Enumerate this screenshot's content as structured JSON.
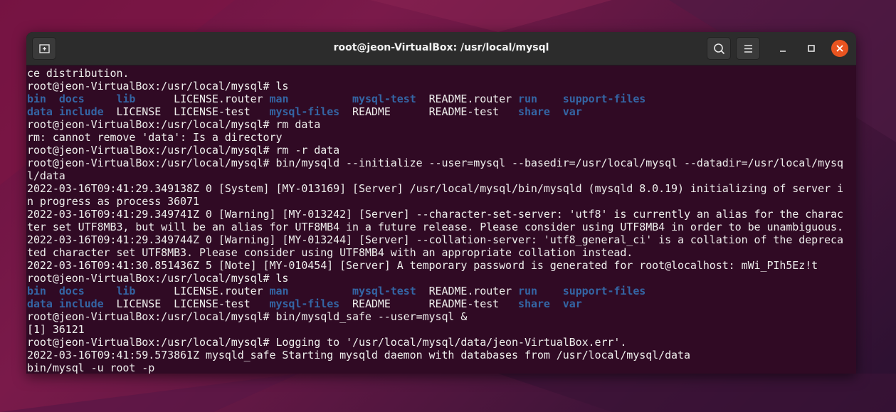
{
  "window": {
    "title": "root@jeon-VirtualBox: /usr/local/mysql"
  },
  "colors": {
    "terminal_bg": "#300a24",
    "terminal_fg": "#eeeeec",
    "directory_blue": "#3465a4",
    "titlebar_bg": "#2c2c2c",
    "close_orange": "#e95420"
  },
  "icons": {
    "new_tab": "new-tab-icon",
    "search": "search-icon",
    "menu": "hamburger-menu-icon",
    "minimize": "minimize-icon",
    "maximize": "maximize-icon",
    "close": "close-icon"
  },
  "terminal": {
    "lines": [
      "ce distribution.",
      "root@jeon-VirtualBox:/usr/local/mysql# ls",
      "root@jeon-VirtualBox:/usr/local/mysql# rm data",
      "rm: cannot remove 'data': Is a directory",
      "root@jeon-VirtualBox:/usr/local/mysql# rm -r data",
      "root@jeon-VirtualBox:/usr/local/mysql# bin/mysqld --initialize --user=mysql --basedir=/usr/local/mysql --datadir=/usr/local/mysq",
      "l/data",
      "2022-03-16T09:41:29.349138Z 0 [System] [MY-013169] [Server] /usr/local/mysql/bin/mysqld (mysqld 8.0.19) initializing of server i",
      "n progress as process 36071",
      "2022-03-16T09:41:29.349741Z 0 [Warning] [MY-013242] [Server] --character-set-server: 'utf8' is currently an alias for the charac",
      "ter set UTF8MB3, but will be an alias for UTF8MB4 in a future release. Please consider using UTF8MB4 in order to be unambiguous.",
      "2022-03-16T09:41:29.349744Z 0 [Warning] [MY-013244] [Server] --collation-server: 'utf8_general_ci' is a collation of the depreca",
      "ted character set UTF8MB3. Please consider using UTF8MB4 with an appropriate collation instead.",
      "2022-03-16T09:41:30.851436Z 5 [Note] [MY-010454] [Server] A temporary password is generated for root@localhost: mWi_PIh5Ez!t",
      "root@jeon-VirtualBox:/usr/local/mysql# ls",
      "root@jeon-VirtualBox:/usr/local/mysql# bin/mysqld_safe --user=mysql &",
      "[1] 36121",
      "root@jeon-VirtualBox:/usr/local/mysql# Logging to '/usr/local/mysql/data/jeon-VirtualBox.err'.",
      "2022-03-16T09:41:59.573861Z mysqld_safe Starting mysqld daemon with databases from /usr/local/mysql/data",
      "bin/mysql -u root -p"
    ],
    "ls_row1": [
      "bin",
      "docs",
      "lib",
      "LICENSE.router",
      "man",
      "mysql-test",
      "README.router",
      "run",
      "support-files"
    ],
    "ls_row2": [
      "data",
      "include",
      "LICENSE",
      "LICENSE-test",
      "mysql-files",
      "README",
      "README-test",
      "share",
      "var"
    ],
    "ls_dirs": [
      "bin",
      "docs",
      "lib",
      "man",
      "mysql-test",
      "run",
      "support-files",
      "data",
      "include",
      "mysql-files",
      "share",
      "var"
    ]
  }
}
